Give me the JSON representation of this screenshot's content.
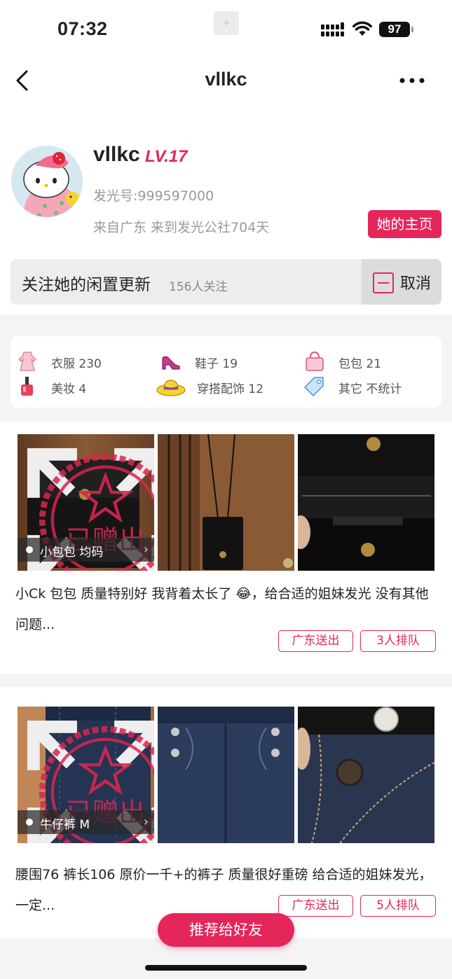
{
  "status_bar": {
    "time": "07:32",
    "battery": "97"
  },
  "nav": {
    "title": "vllkc"
  },
  "profile": {
    "name": "vllkc",
    "level": "LV.17",
    "id": "发光号:999597000",
    "from": "来自广东 来到发光公社704天",
    "home_button": "她的主页",
    "follow_label": "关注她的闲置更新",
    "follow_count": "156人关注",
    "cancel_label": "取消"
  },
  "categories": [
    {
      "label": "衣服 230",
      "icon": "dress-icon"
    },
    {
      "label": "鞋子 19",
      "icon": "high-heel-icon"
    },
    {
      "label": "包包 21",
      "icon": "handbag-icon"
    },
    {
      "label": "美妆 4",
      "icon": "nail-polish-icon"
    },
    {
      "label": "穿搭配饰 12",
      "icon": "sun-hat-icon"
    },
    {
      "label": "其它 不统计",
      "icon": "tag-icon"
    }
  ],
  "listings": [
    {
      "stamp_text": "已赠出",
      "tag": "小包包 均码",
      "description": "小Ck 包包 质量特别好 我背着太长了 😂，给合适的姐妹发光 没有其他问题...",
      "location_badge": "广东送出",
      "queue_badge": "3人排队"
    },
    {
      "stamp_text": "已赠出",
      "tag": "牛仔裤 M",
      "description": "腰围76 裤长106 原价一千+的裤子 质量很好重磅 给合适的姐妹发光，一定...",
      "location_badge": "广东送出",
      "queue_badge": "5人排队"
    }
  ],
  "recommend_button": "推荐给好友",
  "colors": {
    "accent": "#e5265b",
    "level": "#e8245c"
  }
}
